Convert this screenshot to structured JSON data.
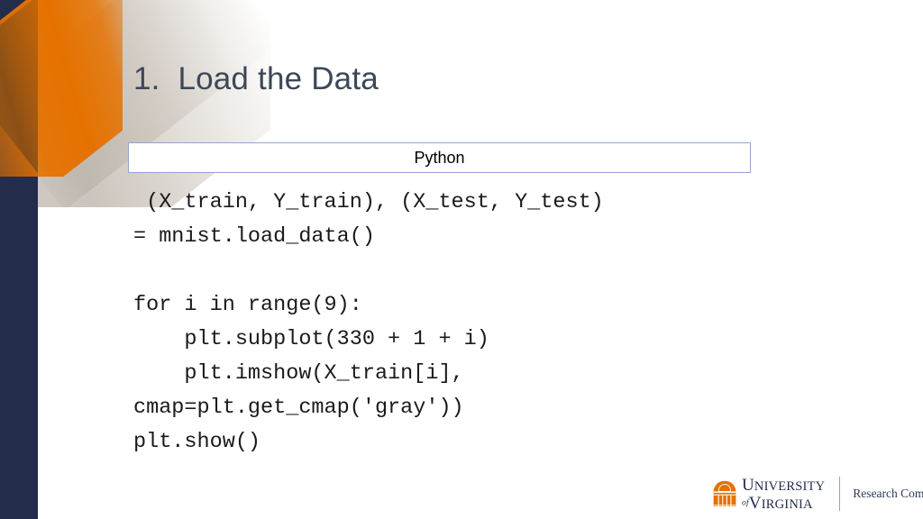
{
  "slide": {
    "title": "1.  Load the Data",
    "background_color": "#ffffff"
  },
  "theme": {
    "navy": "#232D4B",
    "orange": "#E57200",
    "title_color": "#3C4858",
    "box_border_color": "#95A5D0"
  },
  "code_panel": {
    "header_label": "Python",
    "language": "Python",
    "lines": [
      " (X_train, Y_train), (X_test, Y_test)",
      "= mnist.load_data()",
      "",
      "for i in range(9):",
      "    plt.subplot(330 + 1 + i)",
      "    plt.imshow(X_train[i],",
      "cmap=plt.get_cmap('gray'))",
      "plt.show()"
    ]
  },
  "footer": {
    "logo": {
      "icon": "rotunda-icon",
      "wordmark_line1_cap": "U",
      "wordmark_line1_rest": "NIVERSITY",
      "wordmark_of": "of",
      "wordmark_line2_cap": "V",
      "wordmark_line2_rest": "IRGINIA"
    },
    "unit_label": "Research Computing"
  },
  "decoration": {
    "navy_bar": "navy-vertical-bar",
    "orange_stripe": "orange-diagonal-stripe",
    "gray_band": "gray-diagonal-band"
  }
}
